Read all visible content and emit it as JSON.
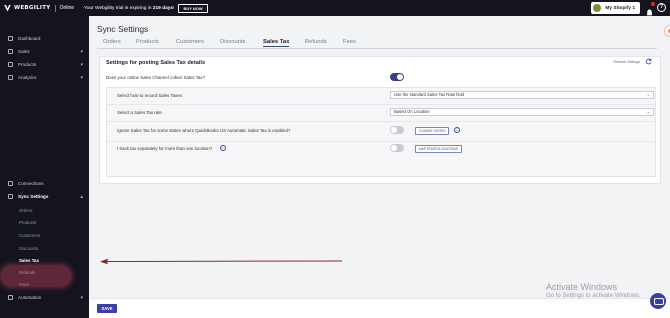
{
  "topbar": {
    "brand": "WEBGILITY",
    "status": "Online",
    "trial_prefix": "Your Webgility trial is expiring in ",
    "trial_days": "219 days",
    "trial_suffix": "!",
    "buy_now": "BUY NOW",
    "store_name": "My Shopify 1",
    "notifications": "1"
  },
  "sidebar": {
    "items": [
      {
        "label": "Dashboard"
      },
      {
        "label": "Sales"
      },
      {
        "label": "Products"
      },
      {
        "label": "Analytics"
      },
      {
        "label": "Connections"
      },
      {
        "label": "Sync Settings"
      },
      {
        "label": "Automation"
      }
    ],
    "sync_sub": [
      {
        "label": "Orders"
      },
      {
        "label": "Products"
      },
      {
        "label": "Customers"
      },
      {
        "label": "Discounts"
      },
      {
        "label": "Sales Tax"
      },
      {
        "label": "Refunds"
      },
      {
        "label": "Fees"
      }
    ]
  },
  "main": {
    "title": "Sync Settings",
    "tabs": [
      {
        "label": "Orders"
      },
      {
        "label": "Products"
      },
      {
        "label": "Customers"
      },
      {
        "label": "Discounts"
      },
      {
        "label": "Sales Tax"
      },
      {
        "label": "Refunds"
      },
      {
        "label": "Fees"
      }
    ],
    "active_tab": "Sales Tax",
    "card": {
      "title": "Settings for posting Sales Tax details",
      "refresh_label": "Refresh Settings",
      "q_collect": "Does your online Sales Channel collect Sales Tax?",
      "q_record": "Select how to record Sales Taxes",
      "record_value": "Use the standard Sales Tax Rate field",
      "q_rate": "Select a Sales Tax rate",
      "rate_value": "Based On Location",
      "q_ignore": "Ignore Sales Tax for some states where QuickBooks US Automatic Sales Tax is enabled?",
      "ignore_button": "CHANGE STATES",
      "q_track": "I track tax separately for more than one location?",
      "track_button": "MAP STATES/LOCATIONS",
      "collect_on": true,
      "ignore_on": false,
      "track_on": false
    }
  },
  "footer": {
    "save": "SAVE"
  },
  "watermark": {
    "line1": "Activate Windows",
    "line2": "Go to Settings to activate Windows."
  },
  "colors": {
    "sidebar_bg": "#14141f",
    "accent": "#3b3fa8",
    "highlight": "#e74c6e",
    "arrow": "#8b2b1e"
  }
}
